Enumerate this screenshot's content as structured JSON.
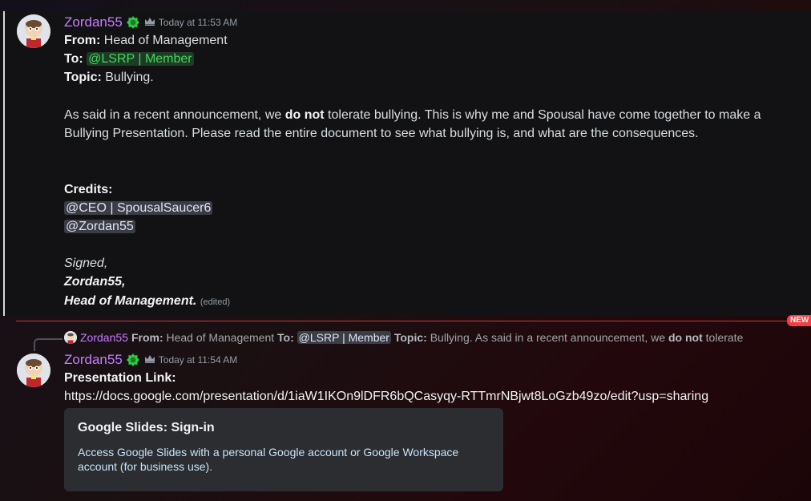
{
  "message1": {
    "username": "Zordan55",
    "timestamp": "Today at 11:53 AM",
    "from_label": "From:",
    "from_value": " Head of Management",
    "to_label": "To:",
    "to_mention": "@LSRP | Member",
    "topic_label": "Topic:",
    "topic_value": " Bullying.",
    "para_a": "As said in a recent announcement, we ",
    "para_bold": "do not",
    "para_b": " tolerate bullying. This is why me and Spousal have come together to make a Bullying Presentation. Please read the entire document to see what bullying is, and what are the consequences.",
    "credits_label": "Credits:",
    "credit_mention_1": "@CEO | SpousalSaucer6",
    "credit_mention_2": "@Zordan55",
    "signed": "Signed,",
    "sig_name": "Zordan55,",
    "sig_title": "Head of Management.",
    "edited": "(edited)"
  },
  "divider": {
    "new_label": "NEW"
  },
  "reply_preview": {
    "username": "Zordan55",
    "from_label": "From:",
    "from_value": "Head of Management",
    "to_label": "To:",
    "to_mention": "@LSRP | Member",
    "topic_label": "Topic:",
    "text_a": "Bullying. As said in a recent announcement, we",
    "text_bold": "do not",
    "text_b": "tolerate"
  },
  "message2": {
    "username": "Zordan55",
    "timestamp": "Today at 11:54 AM",
    "link_label": "Presentation Link:",
    "link_url": "https://docs.google.com/presentation/d/1iaW1IKOn9lDFR6bQCasyqy-RTTmrNBjwt8LoGzb49zo/edit?usp=sharing",
    "embed_title": "Google Slides: Sign-in",
    "embed_description": "Access Google Slides with a personal Google account or Google Workspace account (for business use)."
  },
  "colors": {
    "username": "#c77dff",
    "mention_green": "#3ed85c",
    "new_red": "#f23f43",
    "embed_bg": "#2b2d31"
  },
  "icons": [
    "avatar",
    "role-badge-icon",
    "crown-icon"
  ]
}
